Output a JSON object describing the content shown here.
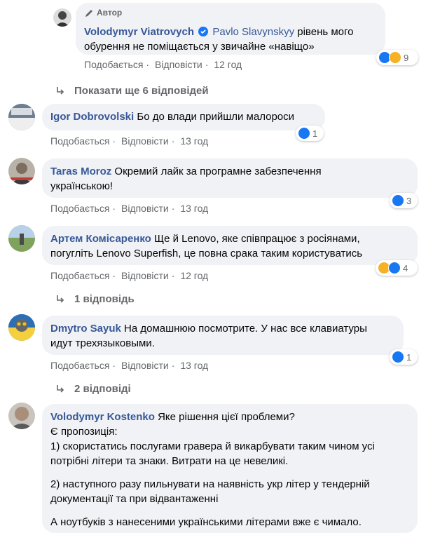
{
  "labels": {
    "like": "Подобається",
    "reply": "Відповісти",
    "author_badge": "Автор"
  },
  "comments": [
    {
      "author": "Volodymyr Viatrovych",
      "mention": "Pavlo Slavynskyy",
      "text_line1": " рівень мого",
      "text_line2": "обурення не поміщається у звичайне «навіщо»",
      "time": "12 год",
      "reactions": [
        "like",
        "haha"
      ],
      "reaction_count": "9"
    },
    {
      "author": "Igor Dobrovolski",
      "text": "Бо до влади прийшли малороси",
      "time": "13 год",
      "reactions": [
        "like"
      ],
      "reaction_count": "1"
    },
    {
      "author": "Taras Moroz",
      "text_line1": "Окремий лайк за програмне забезпечення",
      "text_line2": "українською!",
      "time": "13 год",
      "reactions": [
        "like"
      ],
      "reaction_count": "3"
    },
    {
      "author": "Артем Комісаренко",
      "text_line1": "Ще й Lenovo, яке співпрацює з росіянами,",
      "text_line2": "погугліть Lenovo Superfish, це повна срака таким користуватись",
      "time": "12 год",
      "reactions": [
        "haha",
        "like"
      ],
      "reaction_count": "4"
    },
    {
      "author": "Dmytro Sayuk",
      "text_line1": "На домашнюю посмотрите. У нас все клавиатуры",
      "text_line2": "идут трехязыковыми.",
      "time": "13 год",
      "reactions": [
        "like"
      ],
      "reaction_count": "1"
    },
    {
      "author": "Volodymyr Kostenko",
      "text_line1": "Яке рішення цієї проблеми?",
      "text_line2": "Є пропозиція:",
      "text_line3": "1) скористатись послугами гравера й викарбувати таким чином усі",
      "text_line4": "потрібні літери та знаки. Витрати на це невеликі.",
      "text_line5": "2) наступного разу пильнувати на наявність укр літер у тендерній",
      "text_line6": "документації та при відвантаженні",
      "text_line7": "А ноутбуків з нанесеними українськими літерами вже є чимало."
    }
  ],
  "more_replies": [
    "Показати ще 6 відповідей",
    "1 відповідь",
    "2 відповіді"
  ],
  "colors": {
    "bubble": "#f0f2f5",
    "author_link": "#385898",
    "meta": "#65676b",
    "like": "#1877f2",
    "haha": "#f7b125"
  }
}
